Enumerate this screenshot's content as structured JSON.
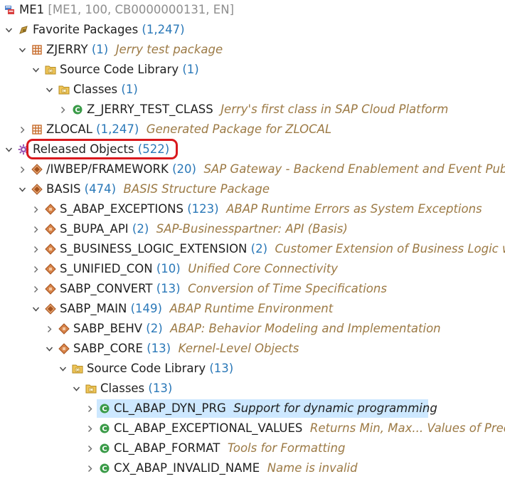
{
  "project": {
    "name": "ME1",
    "context": "[ME1, 100, CB0000000131, EN]"
  },
  "favorite_packages": {
    "label": "Favorite Packages",
    "count": "(1,247)"
  },
  "zjerry": {
    "name": "ZJERRY",
    "count": "(1)",
    "desc": "Jerry test package"
  },
  "zjerry_scl": {
    "name": "Source Code Library",
    "count": "(1)"
  },
  "zjerry_classes": {
    "name": "Classes",
    "count": "(1)"
  },
  "zjerry_class": {
    "name": "Z_JERRY_TEST_CLASS",
    "desc": "Jerry's first class in SAP Cloud Platform"
  },
  "zlocal": {
    "name": "ZLOCAL",
    "count": "(1,247)",
    "desc": "Generated Package for ZLOCAL"
  },
  "released_objects": {
    "label": "Released Objects",
    "count": "(522)"
  },
  "iwbep": {
    "name": "/IWBEP/FRAMEWORK",
    "count": "(20)",
    "desc": "SAP Gateway - Backend Enablement and Event Publis"
  },
  "basis": {
    "name": "BASIS",
    "count": "(474)",
    "desc": "BASIS Structure Package"
  },
  "s_abap_exceptions": {
    "name": "S_ABAP_EXCEPTIONS",
    "count": "(123)",
    "desc": "ABAP Runtime Errors as System Exceptions"
  },
  "s_bupa_api": {
    "name": "S_BUPA_API",
    "count": "(2)",
    "desc": "SAP-Businesspartner: API (Basis)"
  },
  "s_business_logic_extension": {
    "name": "S_BUSINESS_LOGIC_EXTENSION",
    "count": "(2)",
    "desc": "Customer Extension of Business Logic with"
  },
  "s_unified_con": {
    "name": "S_UNIFIED_CON",
    "count": "(10)",
    "desc": "Unified Core Connectivity"
  },
  "sabp_convert": {
    "name": "SABP_CONVERT",
    "count": "(13)",
    "desc": "Conversion of Time Specifications"
  },
  "sabp_main": {
    "name": "SABP_MAIN",
    "count": "(149)",
    "desc": "ABAP Runtime Environment"
  },
  "sabp_behv": {
    "name": "SABP_BEHV",
    "count": "(2)",
    "desc": "ABAP: Behavior Modeling and Implementation"
  },
  "sabp_core": {
    "name": "SABP_CORE",
    "count": "(13)",
    "desc": "Kernel-Level Objects"
  },
  "sabp_core_scl": {
    "name": "Source Code Library",
    "count": "(13)"
  },
  "sabp_core_classes": {
    "name": "Classes",
    "count": "(13)"
  },
  "cl_abap_dyn_prg": {
    "name": "CL_ABAP_DYN_PRG",
    "desc": "Support for dynamic programming"
  },
  "cl_abap_exceptional_values": {
    "name": "CL_ABAP_EXCEPTIONAL_VALUES",
    "desc": "Returns Min, Max... Values of Prede"
  },
  "cl_abap_format": {
    "name": "CL_ABAP_FORMAT",
    "desc": "Tools for Formatting"
  },
  "cx_abap_invalid_name": {
    "name": "CX_ABAP_INVALID_NAME",
    "desc": "Name is invalid"
  },
  "colors": {
    "count": "#2a78b8",
    "description": "#9c7a45",
    "selection": "#cde8ff",
    "highlight_box": "#d9191e",
    "package_icon": "#c76b2a",
    "class_icon": "#3a9b48"
  }
}
